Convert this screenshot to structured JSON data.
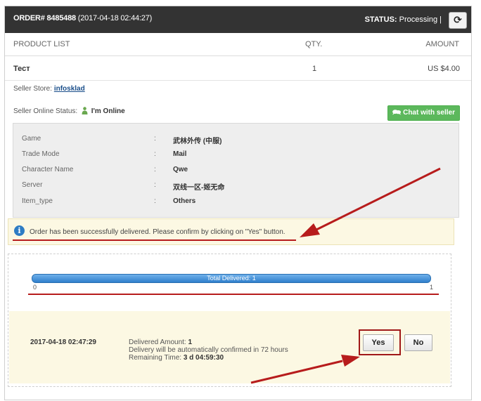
{
  "header": {
    "order_label": "ORDER# 8485488",
    "order_date": "(2017-04-18 02:44:27)",
    "status_label": "STATUS:",
    "status_value": "Processing",
    "status_sep": "|",
    "refresh_icon": "refresh-icon"
  },
  "columns": {
    "product": "PRODUCT LIST",
    "qty": "QTY.",
    "amount": "AMOUNT"
  },
  "product": {
    "name": "Тест",
    "qty": "1",
    "amount": "US $4.00"
  },
  "seller": {
    "store_label": "Seller Store:",
    "store_name": "infosklad",
    "online_label": "Seller Online Status:",
    "online_value": "I'm Online",
    "chat_button": "Chat with seller",
    "chat_icon": "chat-icon",
    "online_icon": "person-icon"
  },
  "details": [
    {
      "key": "Game",
      "sep": ":",
      "value": "武林外传 (中服)"
    },
    {
      "key": "Trade Mode",
      "sep": ":",
      "value": "Mail"
    },
    {
      "key": "Character Name",
      "sep": ":",
      "value": "Qwe"
    },
    {
      "key": "Server",
      "sep": ":",
      "value": "双线一区-姬无命"
    },
    {
      "key": "Item_type",
      "sep": ":",
      "value": "Others"
    }
  ],
  "notice": {
    "icon": "info-icon",
    "text": "Order has been successfully delivered. Please confirm by clicking on \"Yes\" button."
  },
  "progress": {
    "label": "Total Delivered: 1",
    "min": "0",
    "max": "1",
    "fraction": 1.0
  },
  "delivery": {
    "datetime": "2017-04-18 02:47:29",
    "amount_label": "Delivered Amount:",
    "amount_value": "1",
    "auto_confirm": "Delivery will be automatically confirmed in 72 hours",
    "remaining_label": "Remaining Time:",
    "remaining_value": "3 d 04:59:30",
    "yes_button": "Yes",
    "no_button": "No"
  },
  "colors": {
    "header_bg": "#333333",
    "chat_green": "#5cb85c",
    "progress_blue": "#3d8ad3",
    "notice_bg": "#fcf8e3",
    "annotation_red": "#b71c1c"
  }
}
